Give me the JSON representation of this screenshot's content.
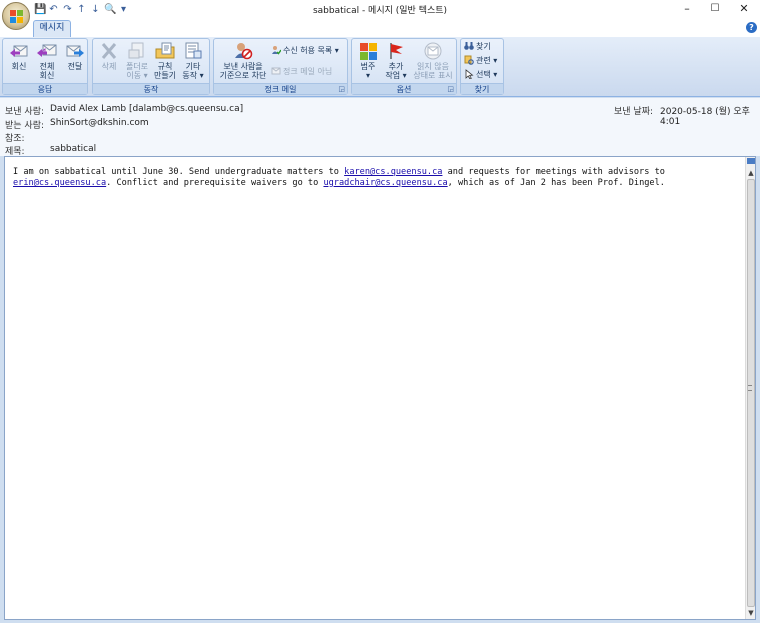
{
  "window": {
    "title": "sabbatical - 메시지 (일반 텍스트)",
    "minimize": "–",
    "maximize": "☐",
    "close": "✕"
  },
  "qat": [
    "💾",
    "↶",
    "↷",
    "↑",
    "↓",
    "🔍",
    "▾"
  ],
  "tabs": [
    {
      "label": "메시지",
      "active": true
    }
  ],
  "help": "?",
  "ribbon": {
    "groups": {
      "respond": {
        "label": "응답",
        "buttons": [
          {
            "label": "회신",
            "icon": "reply-icon"
          },
          {
            "label": "전체\n회신",
            "icon": "reply-all-icon"
          },
          {
            "label": "전달",
            "icon": "forward-icon"
          }
        ]
      },
      "actions": {
        "label": "동작",
        "buttons": [
          {
            "label": "삭제",
            "icon": "delete-icon",
            "disabled": true
          },
          {
            "label": "폴더로\n이동 ▾",
            "icon": "move-to-folder-icon",
            "disabled": true
          },
          {
            "label": "규칙\n만들기",
            "icon": "create-rule-icon"
          },
          {
            "label": "기타\n동작 ▾",
            "icon": "other-actions-icon"
          }
        ]
      },
      "junk": {
        "label": "정크 메일",
        "block_sender": "보낸 사람을\n기준으로 차단",
        "safe_list": "수신 허용 목록 ▾",
        "not_junk": "정크 메일 아님"
      },
      "options": {
        "label": "옵션",
        "categorize": "범주\n▾",
        "follow_up": "추가\n작업 ▾",
        "mark_unread": "읽지 않음\n상태로 표시"
      },
      "find": {
        "label": "찾기",
        "find": "찾기",
        "related": "관련 ▾",
        "select": "선택 ▾"
      }
    }
  },
  "header": {
    "from_label": "보낸 사람:",
    "from_value": "David Alex Lamb [dalamb@cs.queensu.ca]",
    "to_label": "받는 사람:",
    "to_value": "ShinSort@dkshin.com",
    "cc_label": "참조:",
    "cc_value": "",
    "subject_label": "제목:",
    "subject_value": "sabbatical",
    "sent_label": "보낸 날짜:",
    "sent_value": "2020-05-18 (월) 오후 4:01"
  },
  "body": {
    "line1_a": "I am on sabbatical until June 30. Send undergraduate matters to ",
    "link1": "karen@cs.queensu.ca",
    "line1_b": " and requests for meetings with advisors to",
    "link2": "erin@cs.queensu.ca",
    "line2_a": ". Conflict and prerequisite waivers go to ",
    "link3": "ugradchair@cs.queensu.ca",
    "line2_b": ", which as of Jan 2 has been Prof. Dingel."
  },
  "colors": {
    "ribbon_bg": "#dbe7f6",
    "accent": "#15428b",
    "link": "#1a0dab"
  }
}
